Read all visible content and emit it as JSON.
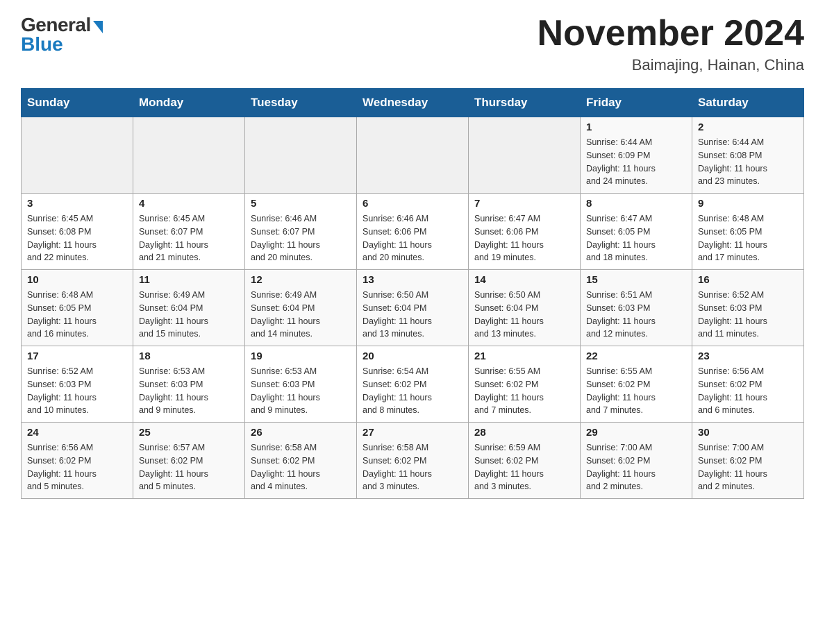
{
  "header": {
    "logo_general": "General",
    "logo_blue": "Blue",
    "month_title": "November 2024",
    "location": "Baimajing, Hainan, China"
  },
  "days_of_week": [
    "Sunday",
    "Monday",
    "Tuesday",
    "Wednesday",
    "Thursday",
    "Friday",
    "Saturday"
  ],
  "weeks": [
    [
      {
        "day": "",
        "info": ""
      },
      {
        "day": "",
        "info": ""
      },
      {
        "day": "",
        "info": ""
      },
      {
        "day": "",
        "info": ""
      },
      {
        "day": "",
        "info": ""
      },
      {
        "day": "1",
        "info": "Sunrise: 6:44 AM\nSunset: 6:09 PM\nDaylight: 11 hours\nand 24 minutes."
      },
      {
        "day": "2",
        "info": "Sunrise: 6:44 AM\nSunset: 6:08 PM\nDaylight: 11 hours\nand 23 minutes."
      }
    ],
    [
      {
        "day": "3",
        "info": "Sunrise: 6:45 AM\nSunset: 6:08 PM\nDaylight: 11 hours\nand 22 minutes."
      },
      {
        "day": "4",
        "info": "Sunrise: 6:45 AM\nSunset: 6:07 PM\nDaylight: 11 hours\nand 21 minutes."
      },
      {
        "day": "5",
        "info": "Sunrise: 6:46 AM\nSunset: 6:07 PM\nDaylight: 11 hours\nand 20 minutes."
      },
      {
        "day": "6",
        "info": "Sunrise: 6:46 AM\nSunset: 6:06 PM\nDaylight: 11 hours\nand 20 minutes."
      },
      {
        "day": "7",
        "info": "Sunrise: 6:47 AM\nSunset: 6:06 PM\nDaylight: 11 hours\nand 19 minutes."
      },
      {
        "day": "8",
        "info": "Sunrise: 6:47 AM\nSunset: 6:05 PM\nDaylight: 11 hours\nand 18 minutes."
      },
      {
        "day": "9",
        "info": "Sunrise: 6:48 AM\nSunset: 6:05 PM\nDaylight: 11 hours\nand 17 minutes."
      }
    ],
    [
      {
        "day": "10",
        "info": "Sunrise: 6:48 AM\nSunset: 6:05 PM\nDaylight: 11 hours\nand 16 minutes."
      },
      {
        "day": "11",
        "info": "Sunrise: 6:49 AM\nSunset: 6:04 PM\nDaylight: 11 hours\nand 15 minutes."
      },
      {
        "day": "12",
        "info": "Sunrise: 6:49 AM\nSunset: 6:04 PM\nDaylight: 11 hours\nand 14 minutes."
      },
      {
        "day": "13",
        "info": "Sunrise: 6:50 AM\nSunset: 6:04 PM\nDaylight: 11 hours\nand 13 minutes."
      },
      {
        "day": "14",
        "info": "Sunrise: 6:50 AM\nSunset: 6:04 PM\nDaylight: 11 hours\nand 13 minutes."
      },
      {
        "day": "15",
        "info": "Sunrise: 6:51 AM\nSunset: 6:03 PM\nDaylight: 11 hours\nand 12 minutes."
      },
      {
        "day": "16",
        "info": "Sunrise: 6:52 AM\nSunset: 6:03 PM\nDaylight: 11 hours\nand 11 minutes."
      }
    ],
    [
      {
        "day": "17",
        "info": "Sunrise: 6:52 AM\nSunset: 6:03 PM\nDaylight: 11 hours\nand 10 minutes."
      },
      {
        "day": "18",
        "info": "Sunrise: 6:53 AM\nSunset: 6:03 PM\nDaylight: 11 hours\nand 9 minutes."
      },
      {
        "day": "19",
        "info": "Sunrise: 6:53 AM\nSunset: 6:03 PM\nDaylight: 11 hours\nand 9 minutes."
      },
      {
        "day": "20",
        "info": "Sunrise: 6:54 AM\nSunset: 6:02 PM\nDaylight: 11 hours\nand 8 minutes."
      },
      {
        "day": "21",
        "info": "Sunrise: 6:55 AM\nSunset: 6:02 PM\nDaylight: 11 hours\nand 7 minutes."
      },
      {
        "day": "22",
        "info": "Sunrise: 6:55 AM\nSunset: 6:02 PM\nDaylight: 11 hours\nand 7 minutes."
      },
      {
        "day": "23",
        "info": "Sunrise: 6:56 AM\nSunset: 6:02 PM\nDaylight: 11 hours\nand 6 minutes."
      }
    ],
    [
      {
        "day": "24",
        "info": "Sunrise: 6:56 AM\nSunset: 6:02 PM\nDaylight: 11 hours\nand 5 minutes."
      },
      {
        "day": "25",
        "info": "Sunrise: 6:57 AM\nSunset: 6:02 PM\nDaylight: 11 hours\nand 5 minutes."
      },
      {
        "day": "26",
        "info": "Sunrise: 6:58 AM\nSunset: 6:02 PM\nDaylight: 11 hours\nand 4 minutes."
      },
      {
        "day": "27",
        "info": "Sunrise: 6:58 AM\nSunset: 6:02 PM\nDaylight: 11 hours\nand 3 minutes."
      },
      {
        "day": "28",
        "info": "Sunrise: 6:59 AM\nSunset: 6:02 PM\nDaylight: 11 hours\nand 3 minutes."
      },
      {
        "day": "29",
        "info": "Sunrise: 7:00 AM\nSunset: 6:02 PM\nDaylight: 11 hours\nand 2 minutes."
      },
      {
        "day": "30",
        "info": "Sunrise: 7:00 AM\nSunset: 6:02 PM\nDaylight: 11 hours\nand 2 minutes."
      }
    ]
  ]
}
